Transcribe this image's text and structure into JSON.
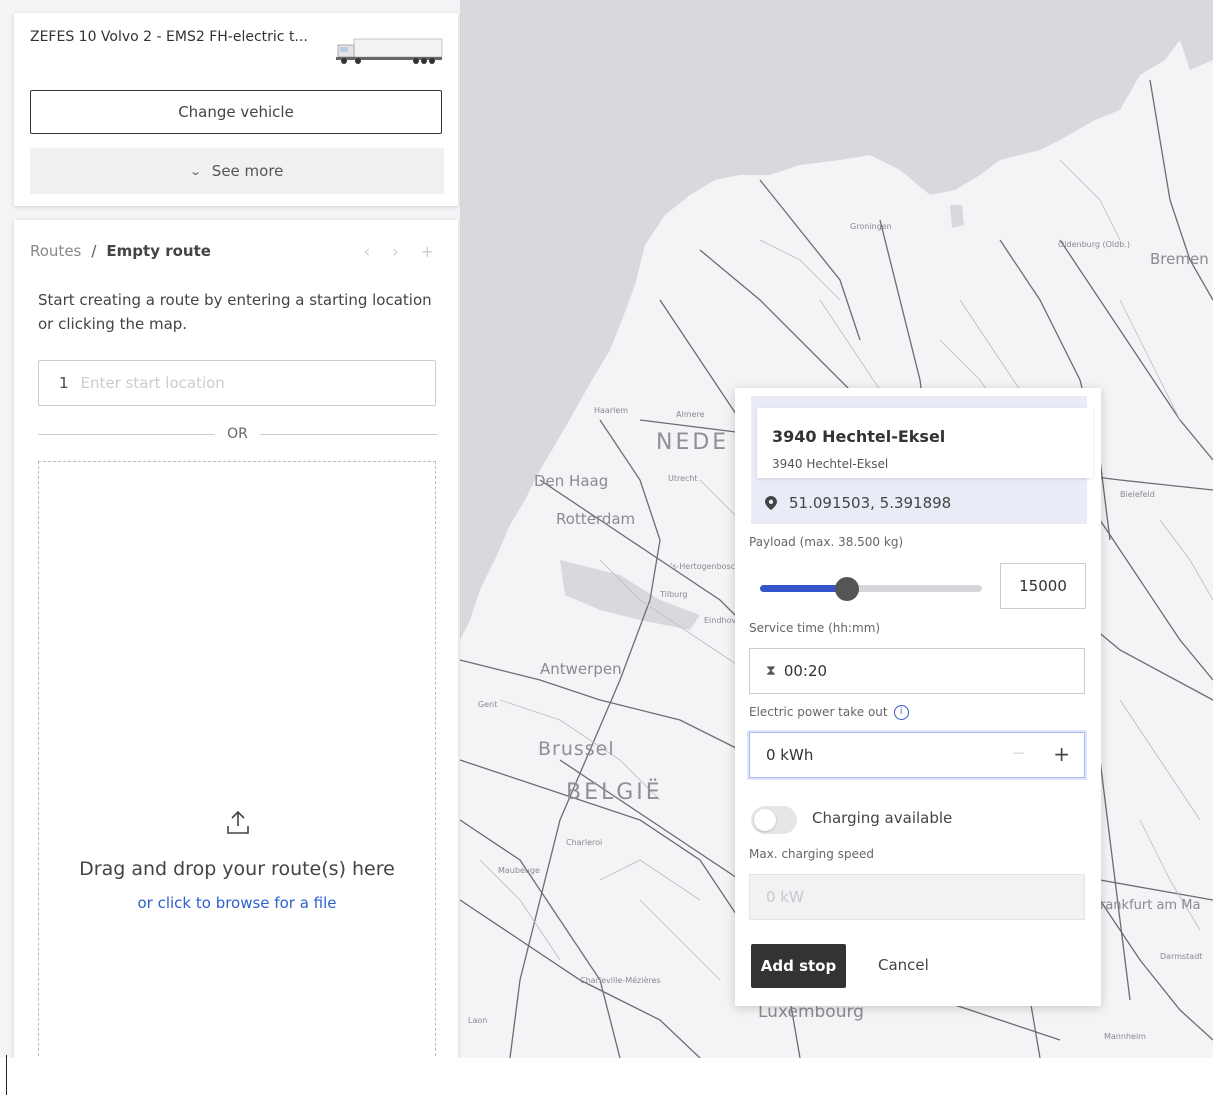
{
  "vehicle": {
    "title": "ZEFES 10 Volvo 2 - EMS2 FH-electric t...",
    "change_label": "Change vehicle",
    "see_more_label": "See more",
    "truck_image": "truck-trailer-image"
  },
  "routes": {
    "breadcrumb_root": "Routes",
    "breadcrumb_separator": "/",
    "breadcrumb_current": "Empty route",
    "nav_prev": "‹",
    "nav_next": "›",
    "nav_add": "+",
    "helper_text": "Start creating a route by entering a starting location or clicking the map.",
    "start_index": "1",
    "start_placeholder": "Enter start location",
    "or_label": "OR",
    "drop_title": "Drag and drop your route(s) here",
    "browse_link": "or click to browse for a file"
  },
  "stop": {
    "location_name": "3940 Hechtel-Eksel",
    "location_sub": "3940 Hechtel-Eksel",
    "coordinates": "51.091503, 5.391898",
    "payload_label": "Payload (max. 38.500 kg)",
    "payload_value": "15000",
    "payload_fraction": 0.39,
    "service_label": "Service time (hh:mm)",
    "service_value": "00:20",
    "power_label": "Electric power take out",
    "power_value": "0 kWh",
    "power_minus": "−",
    "power_plus": "+",
    "charging_label": "Charging available",
    "charging_enabled": false,
    "max_speed_label": "Max. charging speed",
    "max_speed_placeholder": "0 kW",
    "add_label": "Add stop",
    "cancel_label": "Cancel"
  },
  "map": {
    "labels": {
      "groningen": "Groningen",
      "oldenburg": "Oldenburg (Oldb.)",
      "bremen": "Bremen",
      "nede": "NEDE",
      "den_haag": "Den Haag",
      "rotterdam": "Rotterdam",
      "haarlem": "Haarlem",
      "almere": "Almere",
      "utrecht": "Utrecht",
      "bielefeld": "Bielefeld",
      "antwerpen": "Antwerpen",
      "brussel": "Brussel",
      "belgie": "BELGIË",
      "charleroi": "Charleroi",
      "frankfurt": "rankfurt am Ma",
      "luxembourg": "Luxembourg",
      "eindhoven": "Eindhoven",
      "tilburg": "Tilburg",
      "gent": "Gent",
      "maubeuge": "Maubeuge",
      "darmstadt": "Darmstadt",
      "charleville": "Charleville-Mézières",
      "laon": "Laon",
      "mannheim": "Mannheim",
      "hertogenbosch": "'s-Hertogenbosch"
    },
    "colors": {
      "land": "#f4f4f6",
      "water": "#d9d9dd",
      "roads": "#6c6c72",
      "minor": "#bcbcc2"
    }
  }
}
